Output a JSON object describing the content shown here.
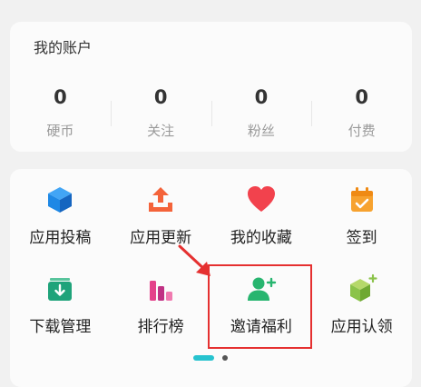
{
  "account": {
    "title": "我的账户",
    "stats": [
      {
        "value": "0",
        "label": "硬币"
      },
      {
        "value": "0",
        "label": "关注"
      },
      {
        "value": "0",
        "label": "粉丝"
      },
      {
        "value": "0",
        "label": "付费"
      }
    ]
  },
  "menu": {
    "items": [
      {
        "label": "应用投稿",
        "icon": "cube-icon",
        "color": "#1e88e5"
      },
      {
        "label": "应用更新",
        "icon": "upload-icon",
        "color": "#f4633a"
      },
      {
        "label": "我的收藏",
        "icon": "heart-icon",
        "color": "#f2424d"
      },
      {
        "label": "签到",
        "icon": "calendar-check-icon",
        "color": "#f7a22f"
      },
      {
        "label": "下载管理",
        "icon": "download-box-icon",
        "color": "#1fa37a"
      },
      {
        "label": "排行榜",
        "icon": "bar-chart-icon",
        "color": "#e4408a"
      },
      {
        "label": "邀请福利",
        "icon": "add-user-icon",
        "color": "#27b56f"
      },
      {
        "label": "应用认领",
        "icon": "cube-plus-icon",
        "color": "#8bc34a"
      }
    ]
  },
  "pager": {
    "pages": 2,
    "current": 1
  },
  "colors": {
    "highlight": "#e53030",
    "pager_active": "#27c3cf"
  }
}
